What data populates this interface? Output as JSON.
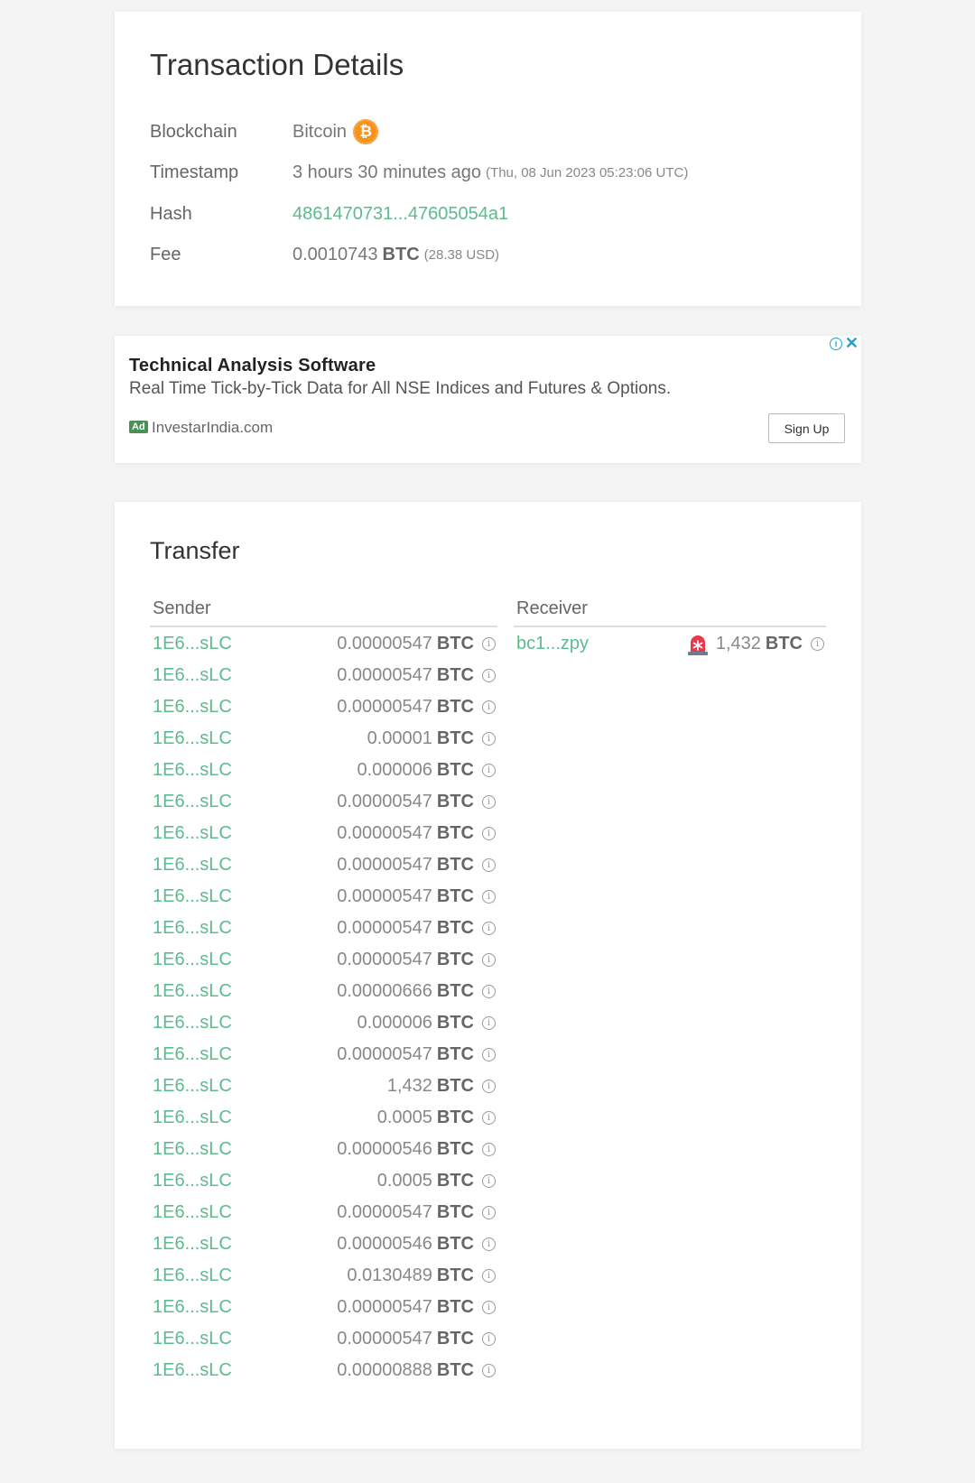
{
  "details": {
    "title": "Transaction Details",
    "blockchain_label": "Blockchain",
    "blockchain_value": "Bitcoin",
    "timestamp_label": "Timestamp",
    "timestamp_relative": "3 hours 30 minutes ago",
    "timestamp_absolute": "(Thu, 08 Jun 2023 05:23:06 UTC)",
    "hash_label": "Hash",
    "hash_value": "4861470731...47605054a1",
    "fee_label": "Fee",
    "fee_amount": "0.0010743",
    "fee_unit": "BTC",
    "fee_usd": "(28.38 USD)"
  },
  "ad": {
    "title": "Technical Analysis Software",
    "description": "Real Time Tick-by-Tick Data for All NSE Indices and Futures & Options.",
    "badge": "Ad",
    "domain": "InvestarIndia.com",
    "button_label": "Sign Up"
  },
  "transfer": {
    "title": "Transfer",
    "sender_header": "Sender",
    "receiver_header": "Receiver",
    "unit": "BTC",
    "senders": [
      {
        "address": "1E6...sLC",
        "amount": "0.00000547"
      },
      {
        "address": "1E6...sLC",
        "amount": "0.00000547"
      },
      {
        "address": "1E6...sLC",
        "amount": "0.00000547"
      },
      {
        "address": "1E6...sLC",
        "amount": "0.00001"
      },
      {
        "address": "1E6...sLC",
        "amount": "0.000006"
      },
      {
        "address": "1E6...sLC",
        "amount": "0.00000547"
      },
      {
        "address": "1E6...sLC",
        "amount": "0.00000547"
      },
      {
        "address": "1E6...sLC",
        "amount": "0.00000547"
      },
      {
        "address": "1E6...sLC",
        "amount": "0.00000547"
      },
      {
        "address": "1E6...sLC",
        "amount": "0.00000547"
      },
      {
        "address": "1E6...sLC",
        "amount": "0.00000547"
      },
      {
        "address": "1E6...sLC",
        "amount": "0.00000666"
      },
      {
        "address": "1E6...sLC",
        "amount": "0.000006"
      },
      {
        "address": "1E6...sLC",
        "amount": "0.00000547"
      },
      {
        "address": "1E6...sLC",
        "amount": "1,432"
      },
      {
        "address": "1E6...sLC",
        "amount": "0.0005"
      },
      {
        "address": "1E6...sLC",
        "amount": "0.00000546"
      },
      {
        "address": "1E6...sLC",
        "amount": "0.0005"
      },
      {
        "address": "1E6...sLC",
        "amount": "0.00000547"
      },
      {
        "address": "1E6...sLC",
        "amount": "0.00000546"
      },
      {
        "address": "1E6...sLC",
        "amount": "0.0130489"
      },
      {
        "address": "1E6...sLC",
        "amount": "0.00000547"
      },
      {
        "address": "1E6...sLC",
        "amount": "0.00000547"
      },
      {
        "address": "1E6...sLC",
        "amount": "0.00000888"
      }
    ],
    "receivers": [
      {
        "address": "bc1...zpy",
        "amount": "1,432",
        "alert_icon": "alarm-siren-icon"
      }
    ]
  },
  "colors": {
    "link": "#5dbb8e",
    "bitcoin": "#f7931a",
    "ad_accent": "#1aa2d6"
  }
}
